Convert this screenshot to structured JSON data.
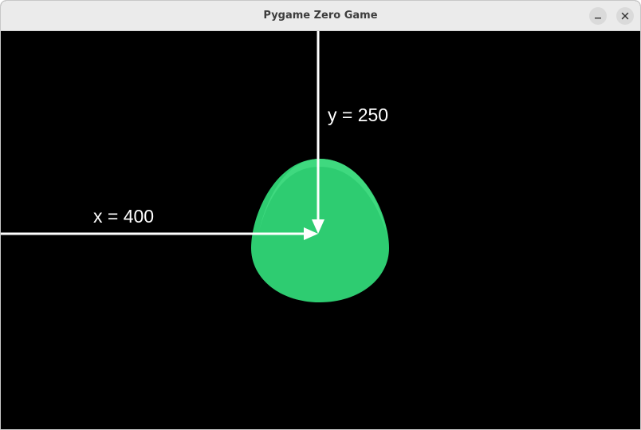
{
  "window": {
    "title": "Pygame Zero Game"
  },
  "controls": {
    "minimize_icon": "minimize-icon",
    "close_icon": "close-icon"
  },
  "canvas": {
    "background": "#000000",
    "x_label": "x = 400",
    "y_label": "y = 250",
    "arrow_color": "#ffffff",
    "sprite": {
      "name": "green-blob-sprite",
      "color": "#2ecc71",
      "highlight_color": "#3fd97f"
    }
  }
}
